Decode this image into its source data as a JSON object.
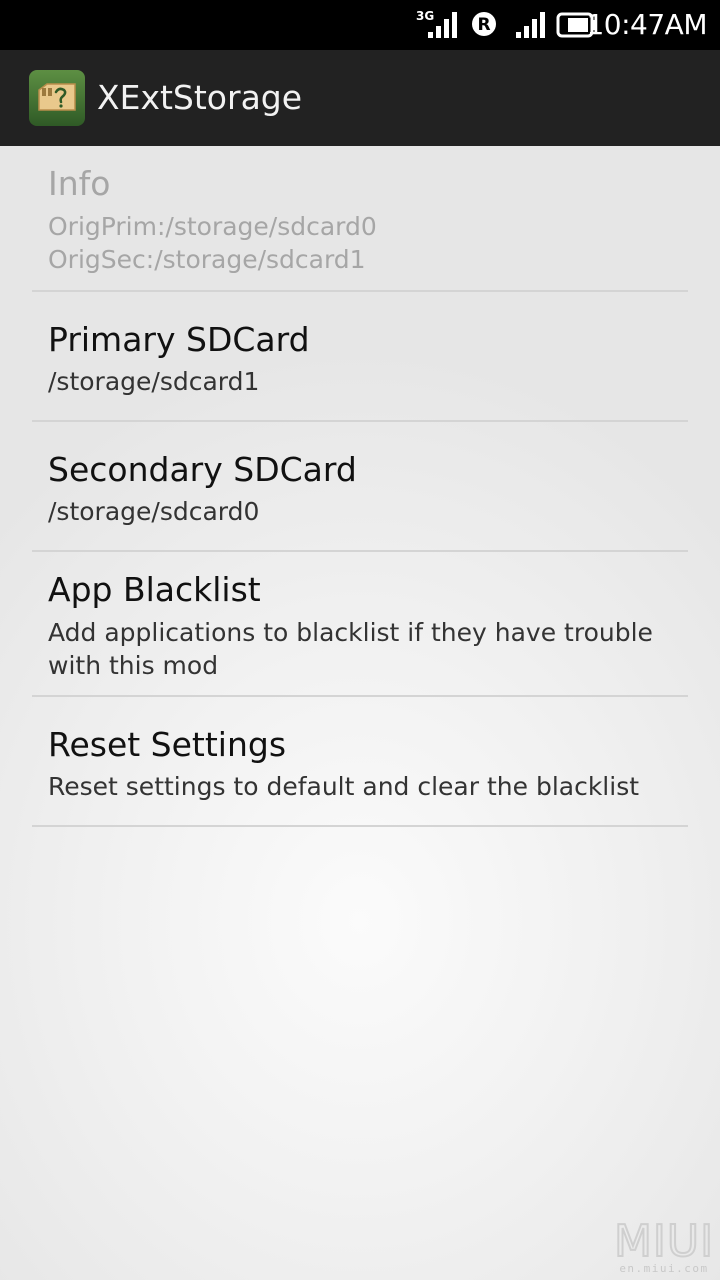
{
  "status_bar": {
    "network": "3G",
    "roaming": "R",
    "time": "10:47AM"
  },
  "action_bar": {
    "app_title": "XExtStorage",
    "app_icon": "sdcard-app-icon"
  },
  "preferences": [
    {
      "title": "Info",
      "summary": "OrigPrim:/storage/sdcard0\nOrigSec:/storage/sdcard1",
      "enabled": false
    },
    {
      "title": "Primary SDCard",
      "summary": "/storage/sdcard1",
      "enabled": true
    },
    {
      "title": "Secondary SDCard",
      "summary": "/storage/sdcard0",
      "enabled": true
    },
    {
      "title": "App Blacklist",
      "summary": "Add applications to blacklist if they have trouble with this mod",
      "enabled": true
    },
    {
      "title": "Reset Settings",
      "summary": "Reset settings to default and clear the blacklist",
      "enabled": true
    }
  ],
  "watermark": {
    "brand": "MIUI",
    "site": "en.miui.com"
  }
}
